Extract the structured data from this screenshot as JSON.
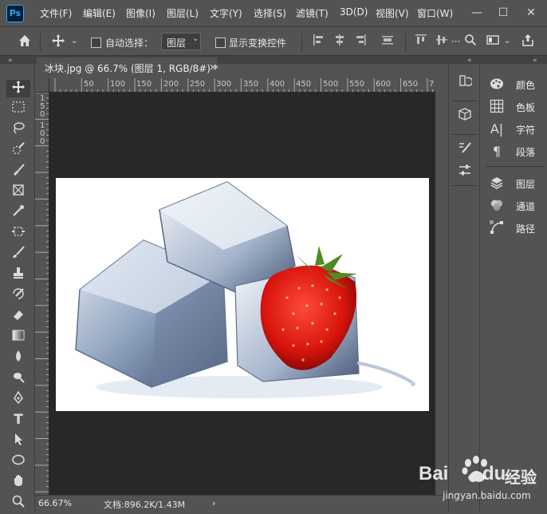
{
  "app": {
    "logo_text": "Ps"
  },
  "menu": [
    "文件(F)",
    "编辑(E)",
    "图像(I)",
    "图层(L)",
    "文字(Y)",
    "选择(S)",
    "滤镜(T)",
    "3D(D)",
    "视图(V)",
    "窗口(W)"
  ],
  "window_controls": {
    "minimize": "—",
    "maximize": "☐",
    "close": "✕"
  },
  "options_bar": {
    "auto_select_label": "自动选择：",
    "auto_select_checked": false,
    "layer_select_value": "图层",
    "show_transform_label": "显示变换控件",
    "show_transform_checked": false
  },
  "document": {
    "tab_title": "冰块.jpg @ 66.7% (图层 1, RGB/8#) *",
    "close": "×",
    "ruler_top_labels": [
      "50",
      "100",
      "150",
      "200",
      "250",
      "300",
      "350",
      "400",
      "450",
      "500",
      "550",
      "600",
      "650",
      "7"
    ],
    "ruler_left_labels": [
      "1",
      "5",
      "0",
      "1",
      "0",
      "0"
    ],
    "image_description": "ice cubes with strawberry"
  },
  "status": {
    "zoom": "66.67%",
    "doc_info": "文档:896.2K/1.43M",
    "arrow": "›"
  },
  "tools": [
    "move-tool",
    "marquee-tool",
    "lasso-tool",
    "quick-select-tool",
    "crop-tool",
    "frame-tool",
    "eyedropper-tool",
    "healing-tool",
    "brush-tool",
    "clone-stamp-tool",
    "history-brush-tool",
    "eraser-tool",
    "gradient-tool",
    "blur-tool",
    "dodge-tool",
    "pen-tool",
    "type-tool",
    "path-select-tool",
    "shape-tool",
    "hand-tool",
    "zoom-tool"
  ],
  "panels": [
    {
      "label": "颜色",
      "icon": "palette-icon"
    },
    {
      "label": "色板",
      "icon": "swatches-icon"
    },
    {
      "label": "字符",
      "icon": "character-icon"
    },
    {
      "label": "段落",
      "icon": "paragraph-icon"
    },
    {
      "label": "图层",
      "icon": "layers-icon"
    },
    {
      "label": "通道",
      "icon": "channels-icon"
    },
    {
      "label": "路径",
      "icon": "paths-icon"
    }
  ],
  "watermark": {
    "brand": "Bai",
    "brand2": "du",
    "brand_cn": "经验",
    "url": "jingyan.baidu.com"
  }
}
